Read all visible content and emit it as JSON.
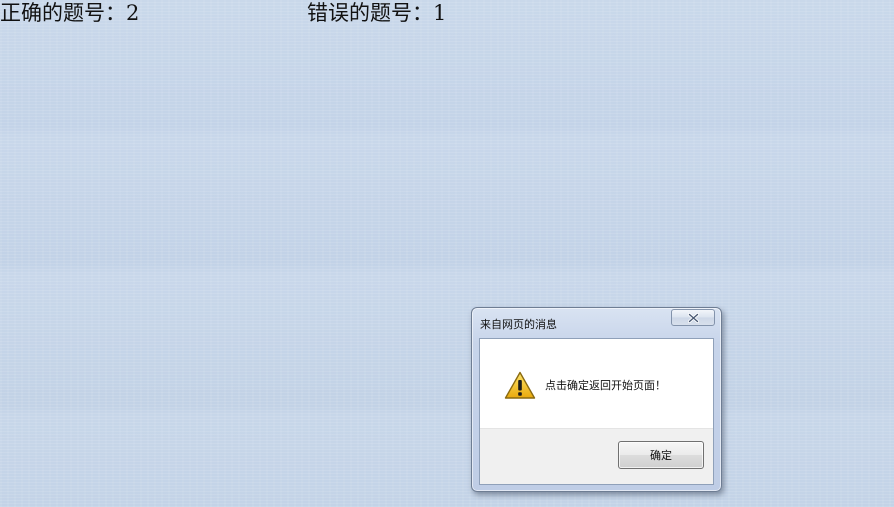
{
  "results": {
    "correct_label": "正确的题号：2",
    "wrong_label": "错误的题号：1"
  },
  "dialog": {
    "title": "来自网页的消息",
    "message": "点击确定返回开始页面！",
    "ok_label": "确定",
    "icon": "warning-icon",
    "close_icon": "close-icon"
  },
  "colors": {
    "background": "#c5d5e9",
    "dialog_frame": "#c7d4ea",
    "warning_yellow": "#f2c21a"
  }
}
